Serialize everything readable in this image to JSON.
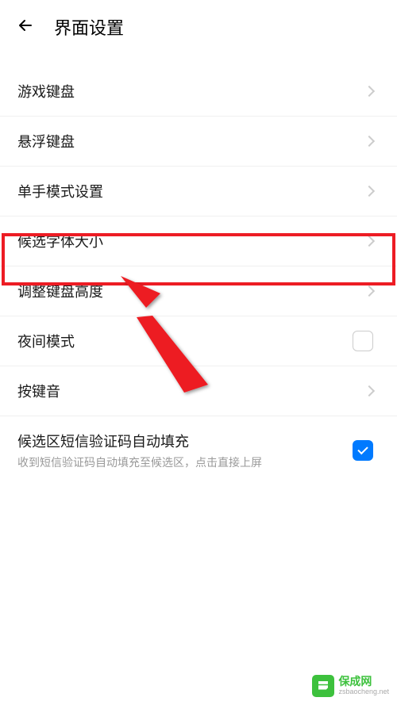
{
  "header": {
    "title": "界面设置"
  },
  "items": {
    "game_keyboard": "游戏键盘",
    "floating_keyboard": "悬浮键盘",
    "one_hand_mode": "单手模式设置",
    "candidate_font_size": "候选字体大小",
    "adjust_keyboard_height": "调整键盘高度",
    "night_mode": "夜间模式",
    "key_sound": "按键音",
    "sms_autofill": "候选区短信验证码自动填充",
    "sms_autofill_sub": "收到短信验证码自动填充至候选区，点击直接上屏"
  },
  "watermark": {
    "title": "保成网",
    "url": "zsbaocheng.net"
  }
}
